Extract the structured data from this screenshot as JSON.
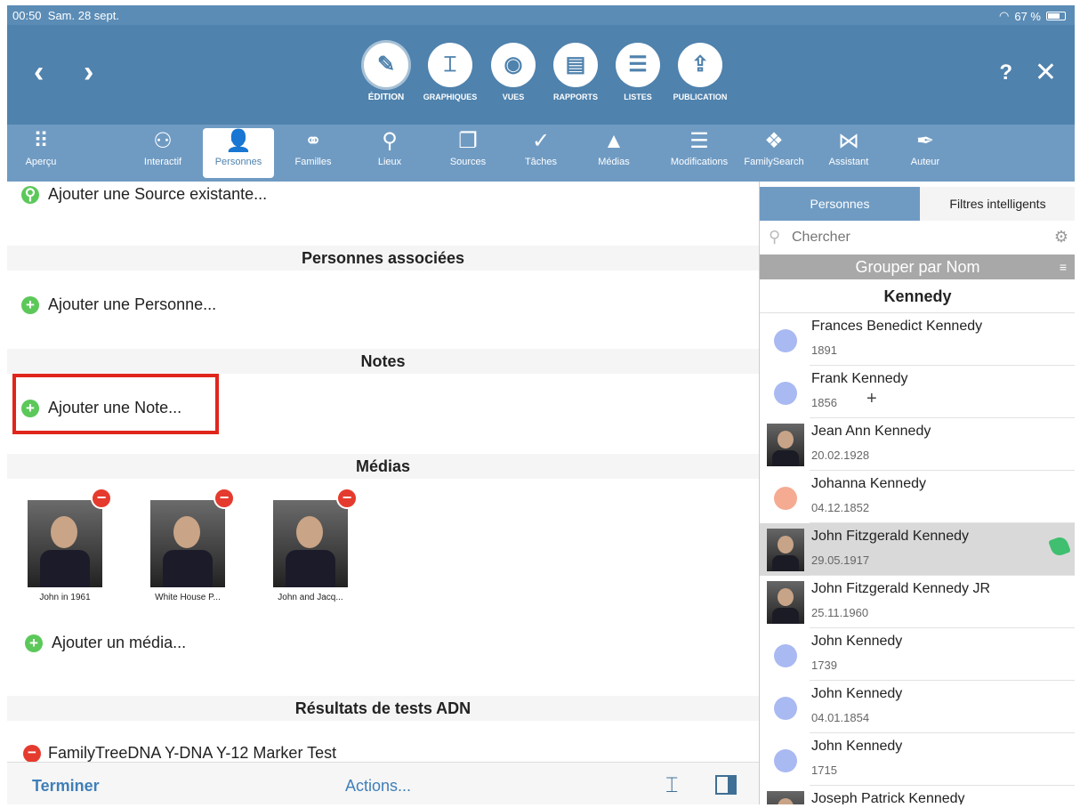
{
  "status": {
    "time": "00:50",
    "date": "Sam. 28 sept.",
    "battery": "67 %"
  },
  "topbar": {
    "back_icon": "chevron-left-icon",
    "forward_icon": "chevron-right-icon",
    "buttons": [
      {
        "label": "ÉDITION",
        "icon": "pencil-icon",
        "glyph": "✎"
      },
      {
        "label": "GRAPHIQUES",
        "icon": "chart-icon",
        "glyph": "⌶"
      },
      {
        "label": "VUES",
        "icon": "eye-icon",
        "glyph": "◉"
      },
      {
        "label": "RAPPORTS",
        "icon": "report-icon",
        "glyph": "▤"
      },
      {
        "label": "LISTES",
        "icon": "list-icon",
        "glyph": "☰"
      },
      {
        "label": "PUBLICATION",
        "icon": "upload-icon",
        "glyph": "⇪"
      }
    ],
    "help": "?",
    "close": "✕"
  },
  "tabs": [
    {
      "label": "Aperçu",
      "glyph": "⠿"
    },
    {
      "label": "Interactif",
      "glyph": "⚇"
    },
    {
      "label": "Personnes",
      "glyph": "👤"
    },
    {
      "label": "Familles",
      "glyph": "⚭"
    },
    {
      "label": "Lieux",
      "glyph": "⚲"
    },
    {
      "label": "Sources",
      "glyph": "❐"
    },
    {
      "label": "Tâches",
      "glyph": "✓"
    },
    {
      "label": "Médias",
      "glyph": "▲"
    },
    {
      "label": "Modifications",
      "glyph": "☰"
    },
    {
      "label": "FamilySearch",
      "glyph": "❖"
    },
    {
      "label": "Assistant",
      "glyph": "⋈"
    },
    {
      "label": "Auteur",
      "glyph": "✒"
    }
  ],
  "main": {
    "add_source": "Ajouter une Source existante...",
    "section_associated": "Personnes associées",
    "add_person": "Ajouter une Personne...",
    "section_notes": "Notes",
    "add_note": "Ajouter une Note...",
    "section_media": "Médias",
    "media": [
      {
        "caption": "John in 1961"
      },
      {
        "caption": "White House P..."
      },
      {
        "caption": "John and Jacq..."
      }
    ],
    "add_media": "Ajouter un média...",
    "section_dna": "Résultats de tests ADN",
    "dna_test": "FamilyTreeDNA Y-DNA Y-12 Marker Test"
  },
  "bottombar": {
    "done": "Terminer",
    "actions": "Actions..."
  },
  "sidebar": {
    "seg_persons": "Personnes",
    "seg_filters": "Filtres intelligents",
    "search_placeholder": "Chercher",
    "group_by": "Grouper par Nom",
    "group_header": "Kennedy",
    "persons": [
      {
        "name": "Frances Benedict Kennedy",
        "date": "1891"
      },
      {
        "name": "Frank Kennedy",
        "date": "1856"
      },
      {
        "name": "Jean Ann Kennedy",
        "date": "20.02.1928"
      },
      {
        "name": "Johanna Kennedy",
        "date": "04.12.1852"
      },
      {
        "name": "John Fitzgerald Kennedy",
        "date": "29.05.1917"
      },
      {
        "name": "John Fitzgerald Kennedy JR",
        "date": "25.11.1960"
      },
      {
        "name": "John Kennedy",
        "date": "1739"
      },
      {
        "name": "John Kennedy",
        "date": "04.01.1854"
      },
      {
        "name": "John Kennedy",
        "date": "1715"
      },
      {
        "name": "Joseph Patrick Kennedy",
        "date": ""
      }
    ]
  },
  "colors": {
    "header": "#4f82ad",
    "tabbar": "#6f9bc3",
    "male_dot": "#a9b9f2",
    "female_dot": "#f5ab92",
    "accent": "#3f7fb8",
    "highlight": "#e0261b"
  }
}
